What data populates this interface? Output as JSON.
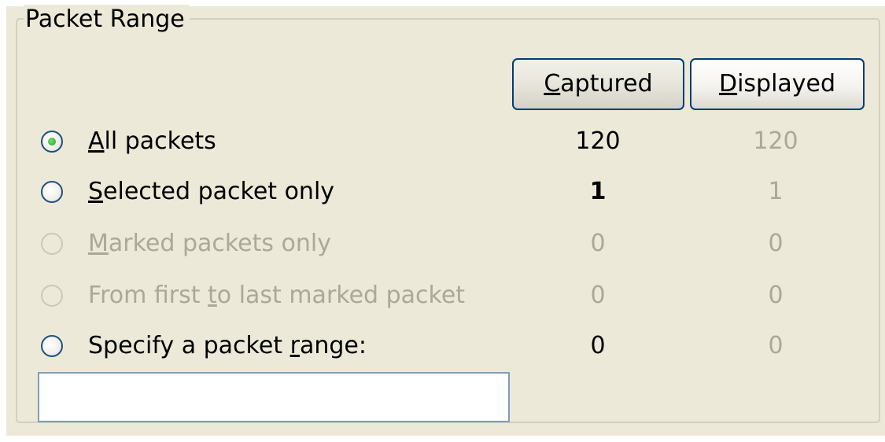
{
  "group_title": "Packet Range",
  "headers": {
    "captured": {
      "accel": "C",
      "rest": "aptured"
    },
    "displayed": {
      "accel": "D",
      "rest": "isplayed"
    }
  },
  "options": [
    {
      "pre": "",
      "accel": "A",
      "post": "ll packets",
      "checked": true,
      "enabled": true,
      "captured": "120",
      "displayed": "120"
    },
    {
      "pre": "",
      "accel": "S",
      "post": "elected packet only",
      "checked": false,
      "enabled": true,
      "captured": "1",
      "displayed": "1"
    },
    {
      "pre": "",
      "accel": "M",
      "post": "arked packets only",
      "checked": false,
      "enabled": false,
      "captured": "0",
      "displayed": "0"
    },
    {
      "pre": "From first ",
      "accel": "t",
      "post": "o last marked packet",
      "checked": false,
      "enabled": false,
      "captured": "0",
      "displayed": "0"
    },
    {
      "pre": "Specify a packet ",
      "accel": "r",
      "post": "ange:",
      "checked": false,
      "enabled": true,
      "captured": "0",
      "displayed": "0"
    }
  ],
  "range_input": {
    "value": ""
  },
  "colors": {
    "dialog_bg": "#ece9d8",
    "disabled_text": "#aca899",
    "radio_border": "#1c5180",
    "radio_dot": "#21a121",
    "button_border": "#003c74",
    "input_border": "#7f9db9"
  }
}
